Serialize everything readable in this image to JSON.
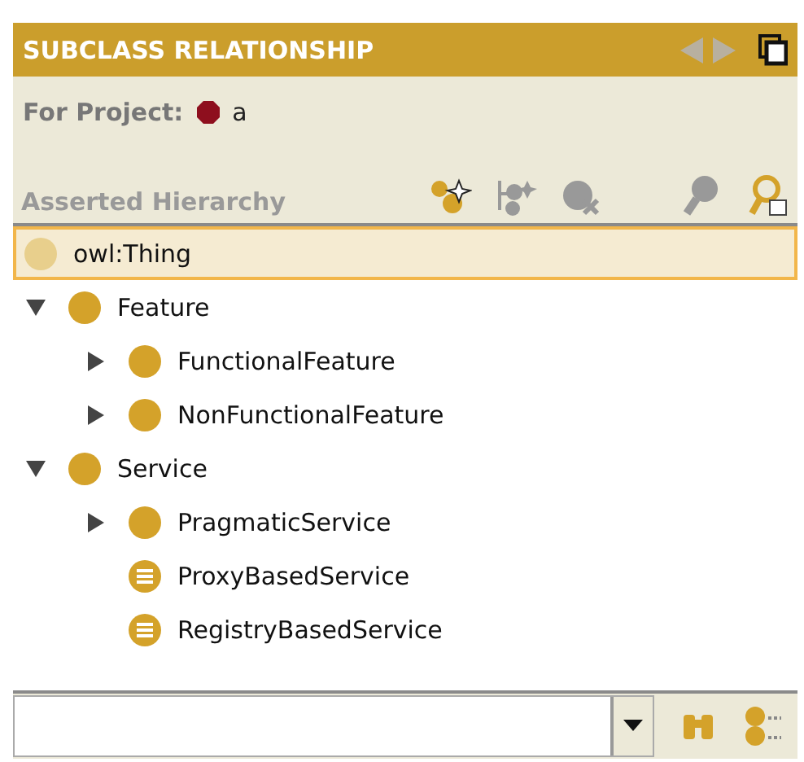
{
  "panel": {
    "title": "SUBCLASS RELATIONSHIP"
  },
  "project": {
    "label": "For Project:",
    "name": "a"
  },
  "hierarchy": {
    "title": "Asserted Hierarchy"
  },
  "tree": [
    {
      "label": "owl:Thing",
      "kind": "thing",
      "selected": true,
      "children": [
        {
          "label": "Feature",
          "kind": "primitive",
          "selected": false,
          "expanded": true,
          "children": [
            {
              "label": "FunctionalFeature",
              "kind": "primitive",
              "selected": false,
              "expanded": false
            },
            {
              "label": "NonFunctionalFeature",
              "kind": "primitive",
              "selected": false,
              "expanded": false
            }
          ]
        },
        {
          "label": "Service",
          "kind": "primitive",
          "selected": false,
          "expanded": true,
          "children": [
            {
              "label": "PragmaticService",
              "kind": "primitive",
              "selected": false,
              "expanded": false
            },
            {
              "label": "ProxyBasedService",
              "kind": "defined",
              "selected": false
            },
            {
              "label": "RegistryBasedService",
              "kind": "defined",
              "selected": false
            }
          ]
        }
      ]
    }
  ]
}
